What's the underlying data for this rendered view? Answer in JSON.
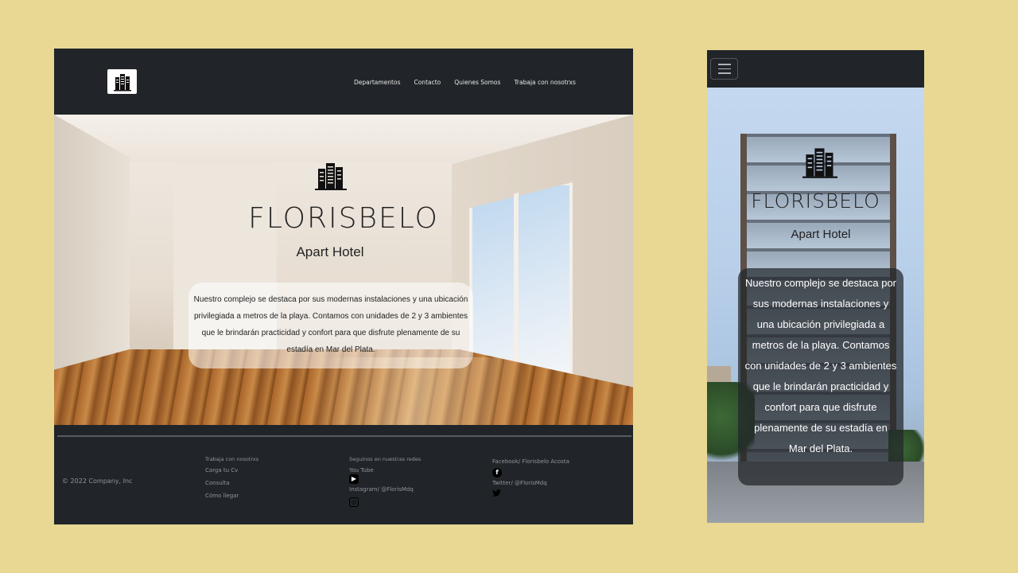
{
  "desktop": {
    "nav": {
      "links": [
        "Departamentos",
        "Contacto",
        "Quienes Somos",
        "Trabaja con nosotrxs"
      ]
    },
    "hero": {
      "brand": "FLORISBELO",
      "subtitle": "Apart Hotel",
      "description": "Nuestro complejo se destaca por sus modernas instalaciones y una ubicación privilegiada a metros de la playa. Contamos con unidades de 2 y 3 ambientes que le brindarán practicidad y confort para que disfrute plenamente de su estadía en Mar del Plata."
    },
    "footer": {
      "copyright": "© 2022 Company, Inc",
      "col1": {
        "heading": "Trabaja con nosotrxs",
        "items": [
          "Carga tu Cv",
          "Consulta",
          "Cómo llegar"
        ]
      },
      "col2": {
        "heading": "Seguinos en nuestras redes",
        "youtube": "You Tube",
        "instagram": "Instagram/ @FlorisMdq"
      },
      "col3": {
        "facebook": "Facebook/ Florisbelo Acosta",
        "twitter": "Twitter/ @FlorisMdq"
      }
    }
  },
  "mobile": {
    "hero": {
      "brand": "FLORISBELO",
      "subtitle": "Apart Hotel",
      "description": "Nuestro complejo se destaca por sus modernas instalaciones y una ubicación privilegiada a metros de la playa. Contamos con unidades de 2 y 3 ambientes que le brindarán practicidad y confort para que disfrute plenamente de su estadía en Mar del Plata."
    }
  },
  "icons": {
    "logo": "building-icon",
    "youtube": "youtube-icon",
    "instagram": "instagram-icon",
    "facebook": "facebook-icon",
    "twitter": "twitter-icon",
    "menu": "hamburger-icon"
  },
  "colors": {
    "background": "#e8d894",
    "navbar": "#212529",
    "footer_text": "#8f959b"
  }
}
